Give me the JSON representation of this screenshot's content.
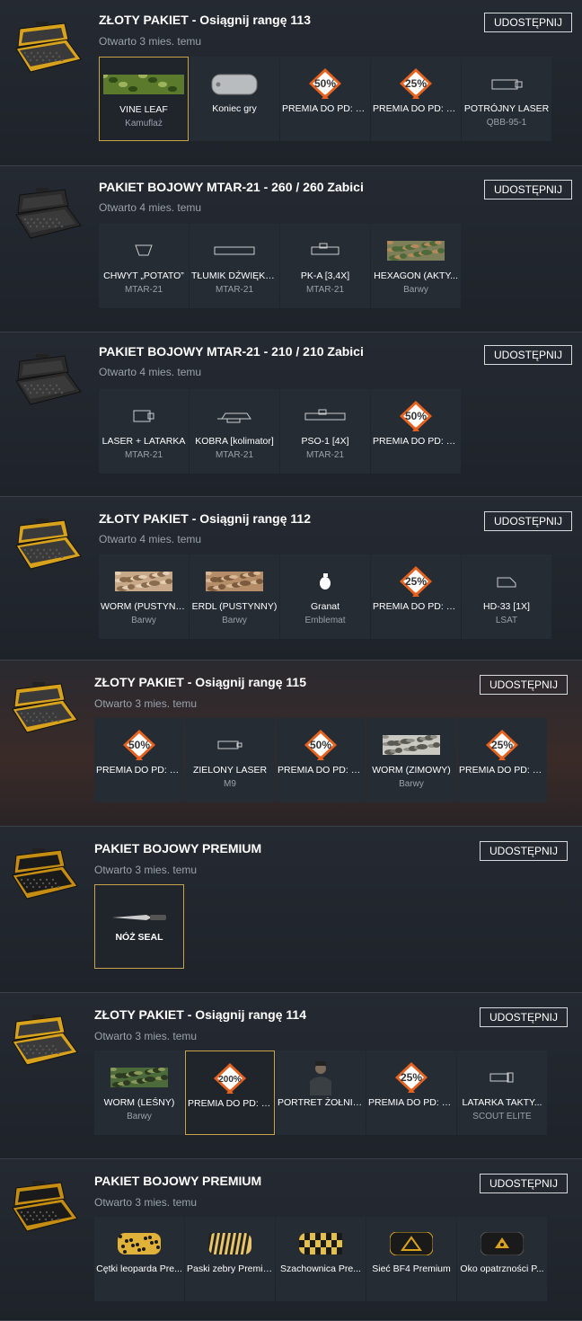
{
  "share_label": "UDOSTĘPNIJ",
  "packs": [
    {
      "title": "ZŁOTY PAKIET - Osiągnij rangę 113",
      "opened": "Otwarto 3 mies. temu",
      "case": "gold",
      "items": [
        {
          "name": "VINE LEAF",
          "cat": "Kamuflaż",
          "icon": "camo-vine",
          "sel": true
        },
        {
          "name": "Koniec gry",
          "cat": "",
          "icon": "dogtag"
        },
        {
          "name": "PREMIA DO PD: 50%",
          "cat": "",
          "icon": "xp-50"
        },
        {
          "name": "PREMIA DO PD: 25%",
          "cat": "",
          "icon": "xp-25"
        },
        {
          "name": "POTRÓJNY LASER",
          "cat": "QBB-95-1",
          "icon": "laser"
        }
      ]
    },
    {
      "title": "PAKIET BOJOWY MTAR-21 - 260 / 260 Zabici",
      "opened": "Otwarto 4 mies. temu",
      "case": "black",
      "items": [
        {
          "name": "CHWYT „POTATO”",
          "cat": "MTAR-21",
          "icon": "grip"
        },
        {
          "name": "TŁUMIK DŹWIĘKU ...",
          "cat": "MTAR-21",
          "icon": "suppressor"
        },
        {
          "name": "PK-A [3,4X]",
          "cat": "MTAR-21",
          "icon": "scope"
        },
        {
          "name": "HEXAGON (AKTY...",
          "cat": "Barwy",
          "icon": "camo-hex"
        }
      ]
    },
    {
      "title": "PAKIET BOJOWY MTAR-21 - 210 / 210 Zabici",
      "opened": "Otwarto 4 mies. temu",
      "case": "black",
      "items": [
        {
          "name": "LASER + LATARKA",
          "cat": "MTAR-21",
          "icon": "laser-light"
        },
        {
          "name": "KOBRA [kolimator]",
          "cat": "MTAR-21",
          "icon": "reddot"
        },
        {
          "name": "PSO-1 [4X]",
          "cat": "MTAR-21",
          "icon": "scope-long"
        },
        {
          "name": "PREMIA DO PD: 50%",
          "cat": "",
          "icon": "xp-50"
        }
      ]
    },
    {
      "title": "ZŁOTY PAKIET - Osiągnij rangę 112",
      "opened": "Otwarto 4 mies. temu",
      "case": "gold",
      "items": [
        {
          "name": "WORM (PUSTYNNY)",
          "cat": "Barwy",
          "icon": "camo-desert"
        },
        {
          "name": "ERDL (PUSTYNNY)",
          "cat": "Barwy",
          "icon": "camo-desert2"
        },
        {
          "name": "Granat",
          "cat": "Emblemat",
          "icon": "grenade"
        },
        {
          "name": "PREMIA DO PD: 25%",
          "cat": "",
          "icon": "xp-25"
        },
        {
          "name": "HD-33 [1X]",
          "cat": "LSAT",
          "icon": "holo"
        }
      ]
    },
    {
      "title": "ZŁOTY PAKIET - Osiągnij rangę 115",
      "opened": "Otwarto 3 mies. temu",
      "case": "gold",
      "items": [
        {
          "name": "PREMIA DO PD: 50%",
          "cat": "",
          "icon": "xp-50"
        },
        {
          "name": "ZIELONY LASER",
          "cat": "M9",
          "icon": "laser-small"
        },
        {
          "name": "PREMIA DO PD: 50%",
          "cat": "",
          "icon": "xp-50"
        },
        {
          "name": "WORM (ZIMOWY)",
          "cat": "Barwy",
          "icon": "camo-winter"
        },
        {
          "name": "PREMIA DO PD: 25%",
          "cat": "",
          "icon": "xp-25"
        }
      ]
    },
    {
      "title": "PAKIET BOJOWY PREMIUM",
      "opened": "Otwarto 3 mies. temu",
      "case": "goldblack",
      "items": [
        {
          "name": "NÓŻ SEAL",
          "cat": "",
          "icon": "knife",
          "sel": true
        }
      ]
    },
    {
      "title": "ZŁOTY PAKIET - Osiągnij rangę 114",
      "opened": "Otwarto 3 mies. temu",
      "case": "gold",
      "items": [
        {
          "name": "WORM (LEŚNY)",
          "cat": "Barwy",
          "icon": "camo-woodland"
        },
        {
          "name": "PREMIA DO PD: 2...",
          "cat": "",
          "icon": "xp-200",
          "sel": true
        },
        {
          "name": "PORTRET ŻOŁNIE...",
          "cat": "",
          "icon": "soldier"
        },
        {
          "name": "PREMIA DO PD: 25%",
          "cat": "",
          "icon": "xp-25"
        },
        {
          "name": "LATARKA TAKTY...",
          "cat": "SCOUT ELITE",
          "icon": "flashlight"
        }
      ]
    },
    {
      "title": "PAKIET BOJOWY PREMIUM",
      "opened": "Otwarto 3 mies. temu",
      "case": "goldblack",
      "items": [
        {
          "name": "Cętki leoparda Pre...",
          "cat": "",
          "icon": "leopard"
        },
        {
          "name": "Paski zebry Premium",
          "cat": "",
          "icon": "zebra"
        },
        {
          "name": "Szachownica Pre...",
          "cat": "",
          "icon": "checker"
        },
        {
          "name": "Sieć BF4 Premium",
          "cat": "",
          "icon": "bf4net"
        },
        {
          "name": "Oko opatrzności P...",
          "cat": "",
          "icon": "eye"
        }
      ]
    }
  ],
  "colors": {
    "gold": "#d9a21c",
    "accent_border": "#c9a24a",
    "xp_orange": "#e8621f"
  }
}
